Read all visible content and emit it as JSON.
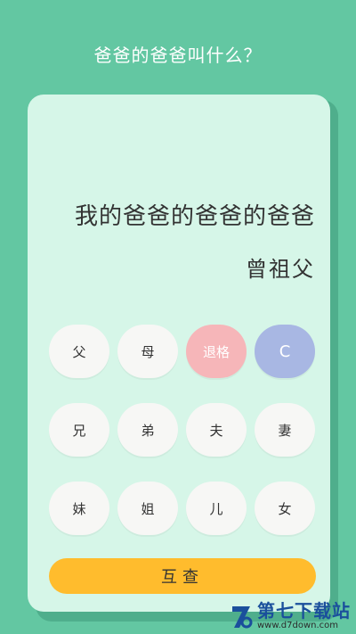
{
  "header": {
    "title": "爸爸的爸爸叫什么？"
  },
  "display": {
    "expression": "我的爸爸的爸爸的爸爸",
    "result": "曾祖父"
  },
  "keys": [
    {
      "label": "父",
      "name": "key-father"
    },
    {
      "label": "母",
      "name": "key-mother"
    },
    {
      "label": "退格",
      "name": "key-backspace"
    },
    {
      "label": "C",
      "name": "key-clear"
    },
    {
      "label": "兄",
      "name": "key-older-brother"
    },
    {
      "label": "弟",
      "name": "key-younger-brother"
    },
    {
      "label": "夫",
      "name": "key-husband"
    },
    {
      "label": "妻",
      "name": "key-wife"
    },
    {
      "label": "妹",
      "name": "key-younger-sister"
    },
    {
      "label": "姐",
      "name": "key-older-sister"
    },
    {
      "label": "儿",
      "name": "key-son"
    },
    {
      "label": "女",
      "name": "key-daughter"
    }
  ],
  "mutual_button": {
    "label": "互查"
  },
  "watermark": {
    "title": "第七下载站",
    "url": "www.d7down.com"
  },
  "colors": {
    "background": "#63c7a2",
    "card": "#d6f6e8",
    "delete_key": "#f6b6b9",
    "clear_key": "#a8b7e3",
    "mutual_button": "#ffbc2d"
  }
}
